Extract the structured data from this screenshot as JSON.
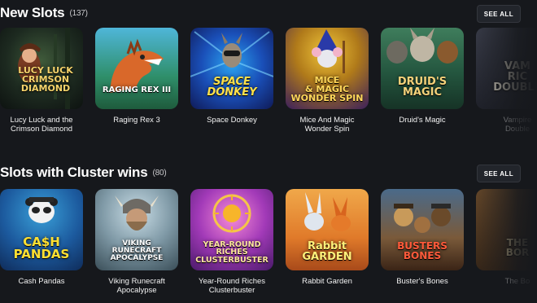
{
  "sections": [
    {
      "title": "New Slots",
      "count": "(137)",
      "see_all": "SEE ALL",
      "games": [
        {
          "name": "Lucy Luck and the\nCrimson Diamond",
          "logo": "LUCY LUCK\nCRIMSON\nDIAMOND"
        },
        {
          "name": "Raging Rex 3",
          "logo": "RAGING REX III"
        },
        {
          "name": "Space Donkey",
          "logo": "SPACE\nDONKEY"
        },
        {
          "name": "Mice And Magic\nWonder Spin",
          "logo": "MICE\n& MAGIC\nWONDER SPIN"
        },
        {
          "name": "Druid's Magic",
          "logo": "DRUID'S\nMAGIC"
        },
        {
          "name": "Vampire\nDouble",
          "logo": "VAM\nRIC\nDOUBLE"
        }
      ]
    },
    {
      "title": "Slots with Cluster wins",
      "count": "(80)",
      "see_all": "SEE ALL",
      "games": [
        {
          "name": "Cash Pandas",
          "logo": "CA$H\nPANDAS"
        },
        {
          "name": "Viking Runecraft\nApocalypse",
          "logo": "VIKING\nRUNECRAFT\nAPOCALYPSE"
        },
        {
          "name": "Year-Round Riches\nClusterbuster",
          "logo": "YEAR-ROUND\nRICHES\nCLUSTERBUSTER"
        },
        {
          "name": "Rabbit Garden",
          "logo": "Rabbit\nGARDEN"
        },
        {
          "name": "Buster's Bones",
          "logo": "BUSTERS\nBONES"
        },
        {
          "name": "The Bo",
          "logo": "THE\nBOR"
        }
      ]
    }
  ],
  "colors": {
    "background": "#16181c",
    "button_bg": "#22252b"
  }
}
